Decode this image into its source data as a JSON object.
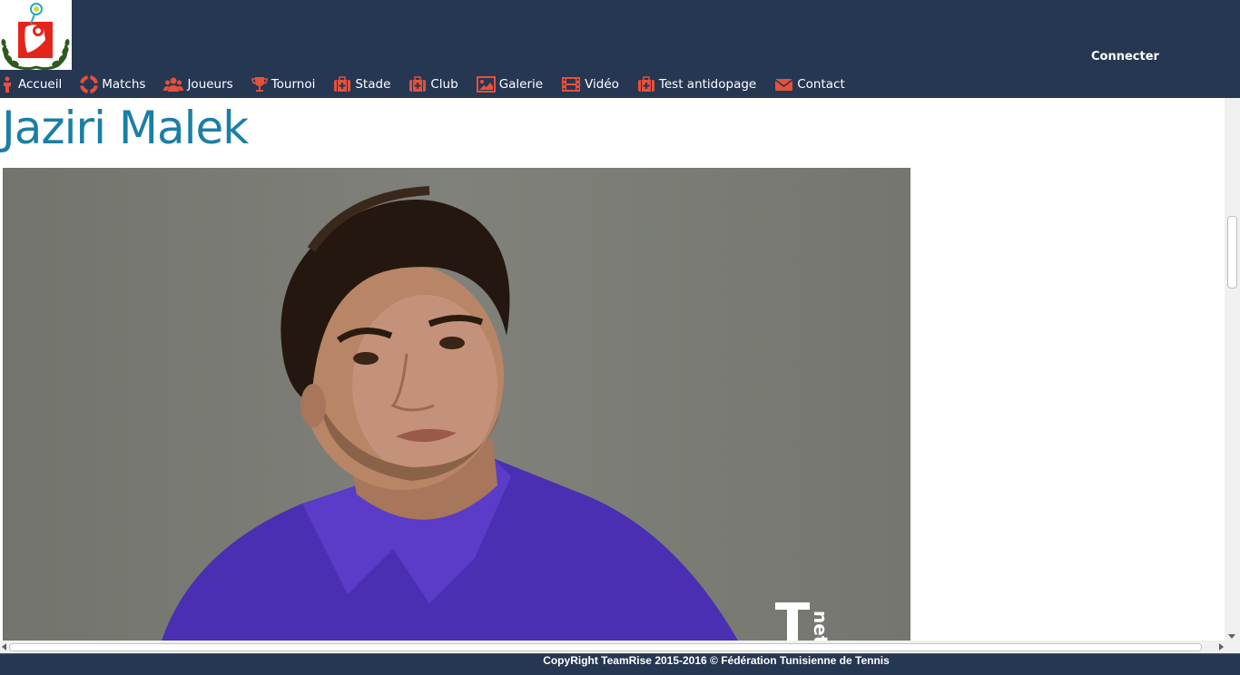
{
  "header": {
    "connect_label": "Connecter",
    "nav": [
      {
        "label": "Accueil",
        "icon": "home-icon"
      },
      {
        "label": "Matchs",
        "icon": "lifebuoy-icon"
      },
      {
        "label": "Joueurs",
        "icon": "users-icon"
      },
      {
        "label": "Tournoi",
        "icon": "trophy-icon"
      },
      {
        "label": "Stade",
        "icon": "medkit-icon"
      },
      {
        "label": "Club",
        "icon": "medkit-icon"
      },
      {
        "label": "Galerie",
        "icon": "image-icon"
      },
      {
        "label": "Vidéo",
        "icon": "film-icon"
      },
      {
        "label": "Test antidopage",
        "icon": "medkit-icon"
      },
      {
        "label": "Contact",
        "icon": "envelope-icon"
      }
    ]
  },
  "main": {
    "player_name": "Jaziri Malek",
    "photo_watermark": "Tnet"
  },
  "footer": {
    "copyright": "CopyRight TeamRise 2015-2016 © Fédération Tunisienne de Tennis"
  },
  "colors": {
    "header_bg": "#263752",
    "icon_accent": "#e8503a",
    "title": "#1a7fa6"
  }
}
